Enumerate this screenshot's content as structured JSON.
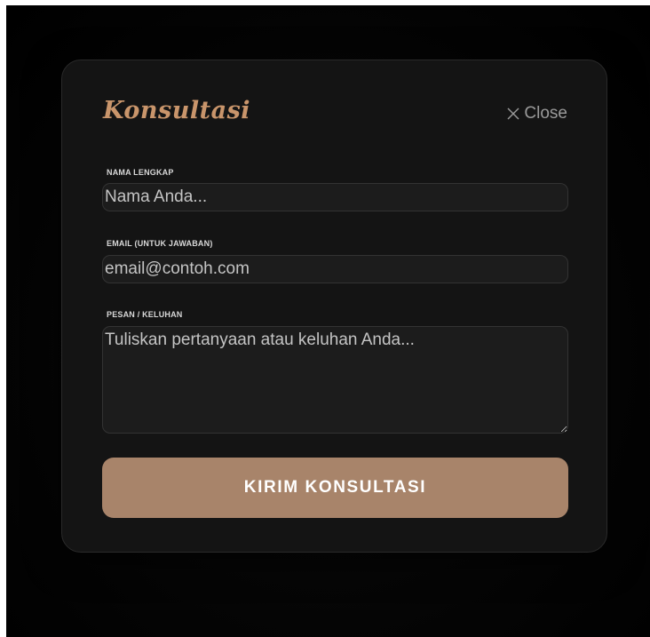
{
  "modal": {
    "title": "Konsultasi",
    "close_label": "Close",
    "close_icon": "close-icon"
  },
  "form": {
    "name": {
      "label": "NAMA LENGKAP",
      "placeholder": "Nama Anda...",
      "value": ""
    },
    "email": {
      "label": "EMAIL (UNTUK JAWABAN)",
      "placeholder": "email@contoh.com",
      "value": ""
    },
    "message": {
      "label": "PESAN / KELUHAN",
      "placeholder": "Tuliskan pertanyaan atau keluhan Anda...",
      "value": ""
    },
    "submit_label": "KIRIM KONSULTASI"
  },
  "colors": {
    "accent": "#c9956b",
    "button": "#a8846a",
    "modal_bg": "#141414",
    "input_bg": "#1c1c1c"
  }
}
